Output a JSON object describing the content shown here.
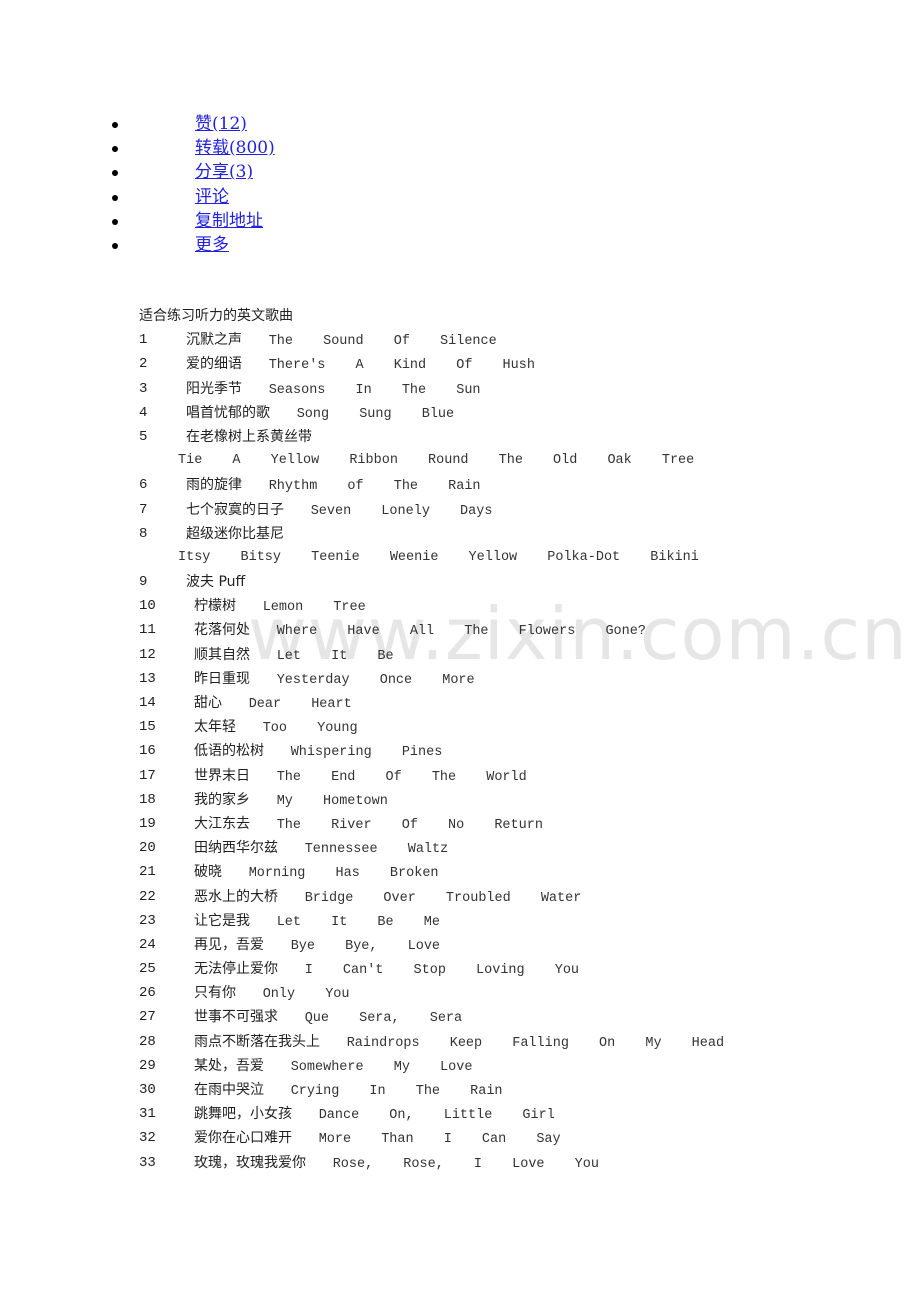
{
  "actions": [
    {
      "label": "赞(12)"
    },
    {
      "label": "转载(800)"
    },
    {
      "label": "分享(3)"
    },
    {
      "label": "评论"
    },
    {
      "label": "复制地址"
    },
    {
      "label": "更多"
    }
  ],
  "watermark": "www.zixin.com.cn",
  "document": {
    "title": "适合练习听力的英文歌曲",
    "songs": [
      {
        "num": "1",
        "cn": "沉默之声",
        "en": "The Sound Of Silence"
      },
      {
        "num": "2",
        "cn": "爱的细语",
        "en": "There's A Kind Of Hush"
      },
      {
        "num": "3",
        "cn": "阳光季节",
        "en": "Seasons In The Sun"
      },
      {
        "num": "4",
        "cn": "唱首忧郁的歌",
        "en": "Song Sung Blue"
      },
      {
        "num": "5",
        "cn": "在老橡树上系黄丝带",
        "en": "Tie A Yellow Ribbon Round The Old Oak Tree"
      },
      {
        "num": "6",
        "cn": "雨的旋律",
        "en": "Rhythm of The Rain"
      },
      {
        "num": "7",
        "cn": "七个寂寞的日子",
        "en": "Seven Lonely Days"
      },
      {
        "num": "8",
        "cn": "超级迷你比基尼",
        "en": "Itsy Bitsy Teenie Weenie Yellow Polka-Dot Bikini"
      },
      {
        "num": "9",
        "cn": "波夫 Puff",
        "en": ""
      },
      {
        "num": "10",
        "cn": "柠檬树",
        "en": "Lemon Tree"
      },
      {
        "num": "11",
        "cn": "花落何处",
        "en": "Where Have All The Flowers Gone?"
      },
      {
        "num": "12",
        "cn": "顺其自然",
        "en": "Let It Be"
      },
      {
        "num": "13",
        "cn": "昨日重现",
        "en": "Yesterday Once More"
      },
      {
        "num": "14",
        "cn": "甜心",
        "en": "Dear Heart"
      },
      {
        "num": "15",
        "cn": "太年轻",
        "en": "Too Young"
      },
      {
        "num": "16",
        "cn": "低语的松树",
        "en": "Whispering Pines"
      },
      {
        "num": "17",
        "cn": "世界末日",
        "en": "The End Of The World"
      },
      {
        "num": "18",
        "cn": "我的家乡",
        "en": "My Hometown"
      },
      {
        "num": "19",
        "cn": "大江东去",
        "en": "The River Of No Return"
      },
      {
        "num": "20",
        "cn": "田纳西华尔兹",
        "en": "Tennessee Waltz"
      },
      {
        "num": "21",
        "cn": "破晓",
        "en": "Morning Has Broken"
      },
      {
        "num": "22",
        "cn": "恶水上的大桥",
        "en": "Bridge Over Troubled Water"
      },
      {
        "num": "23",
        "cn": "让它是我",
        "en": "Let It Be Me"
      },
      {
        "num": "24",
        "cn": "再见，吾爱",
        "en": "Bye Bye, Love"
      },
      {
        "num": "25",
        "cn": "无法停止爱你",
        "en": "I Can't Stop Loving You"
      },
      {
        "num": "26",
        "cn": "只有你",
        "en": "Only You"
      },
      {
        "num": "27",
        "cn": "世事不可强求",
        "en": "Que Sera, Sera"
      },
      {
        "num": "28",
        "cn": "雨点不断落在我头上",
        "en": "Raindrops Keep Falling On My Head"
      },
      {
        "num": "29",
        "cn": "某处，吾爱",
        "en": "Somewhere My Love"
      },
      {
        "num": "30",
        "cn": "在雨中哭泣",
        "en": "Crying In The Rain"
      },
      {
        "num": "31",
        "cn": "跳舞吧，小女孩",
        "en": "Dance On, Little Girl"
      },
      {
        "num": "32",
        "cn": "爱你在心口难开",
        "en": "More Than I Can Say"
      },
      {
        "num": "33",
        "cn": "玫瑰，玫瑰我爱你",
        "en": "Rose, Rose, I Love You"
      }
    ]
  }
}
